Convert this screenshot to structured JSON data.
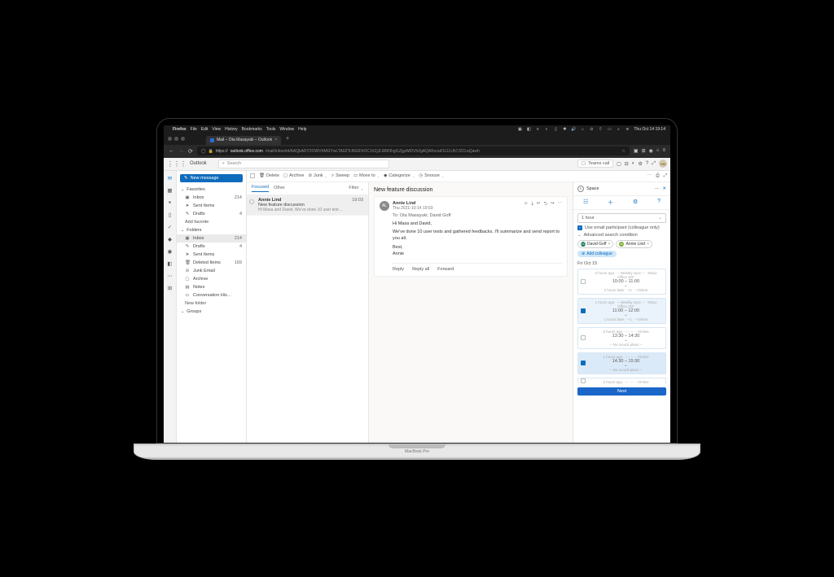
{
  "mac_menu": {
    "app": "Firefox",
    "items": [
      "File",
      "Edit",
      "View",
      "History",
      "Bookmarks",
      "Tools",
      "Window",
      "Help"
    ],
    "clock": "Thu Oct 14  19:14"
  },
  "browser": {
    "tab_title": "Mail – Ota Masayuki – Outlook",
    "url_host": "outlook.office.com",
    "url_path": "/mail/inbox/id/AAQkADY2OWVhMGYwLTA0ZTctNGFhOC1hZjJLWM3hgt1ZjgzMDVh2gAQAKuvaFG1LUh7J2CraQawh"
  },
  "outlook": {
    "title": "Outlook",
    "search_placeholder": "Search",
    "teams_call": "Teams call",
    "new_message": "New message",
    "sections": {
      "favorites": "Favorites",
      "folders": "Folders",
      "groups": "Groups",
      "add_favorite": "Add favorite",
      "new_folder": "New folder"
    },
    "folders_list": [
      {
        "icon": "inbox",
        "label": "Inbox",
        "count": "214"
      },
      {
        "icon": "send",
        "label": "Sent Items",
        "count": ""
      },
      {
        "icon": "draft",
        "label": "Drafts",
        "count": "4"
      },
      {
        "icon": "inbox",
        "label": "Inbox",
        "count": "214"
      },
      {
        "icon": "draft",
        "label": "Drafts",
        "count": "4"
      },
      {
        "icon": "send",
        "label": "Sent Items",
        "count": ""
      },
      {
        "icon": "trash",
        "label": "Deleted Items",
        "count": "169"
      },
      {
        "icon": "junk",
        "label": "Junk Email",
        "count": ""
      },
      {
        "icon": "archive",
        "label": "Archive",
        "count": ""
      },
      {
        "icon": "notes",
        "label": "Notes",
        "count": ""
      },
      {
        "icon": "conv",
        "label": "Conversation His…",
        "count": ""
      }
    ],
    "toolbar": {
      "delete": "Delete",
      "archive": "Archive",
      "junk": "Junk",
      "sweep": "Sweep",
      "move": "Move to",
      "categorize": "Categorize",
      "snooze": "Snooze"
    },
    "tabs": {
      "focused": "Focused",
      "other": "Other",
      "filter": "Filter"
    },
    "message": {
      "from": "Annie Lind",
      "time_short": "19:03",
      "subject": "New feature discussion",
      "preview": "Hi Masa and David, We've done 10 user test…",
      "initials": "AL",
      "timestamp": "Thu 2021-10-14 19:03",
      "to": "To:  Ota Masayuki; David Goff",
      "greeting": "Hi Masa and David,",
      "body": "We've done 10 user tests and gathered feedbacks. I'll summarize and send report to you all.",
      "sign1": "Best,",
      "sign2": "Annie",
      "reply": "Reply",
      "reply_all": "Reply all",
      "forward": "Forward"
    }
  },
  "space": {
    "title": "Space",
    "duration": "1 hour",
    "use_email": "Use email participant (colleague only)",
    "advanced": "Advanced search condition",
    "chips": [
      {
        "initials": "DG",
        "name": "David Goff",
        "color": "#1a7a5a"
      },
      {
        "initials": "AL",
        "name": "Annie Lind",
        "color": "#7aa82e"
      }
    ],
    "add_colleague": "Add colleague",
    "date": "Fri Oct 15",
    "slots": [
      {
        "meta1": "0 hours ago · – Weekly sync – · Tokyo Office 31F",
        "time": "10:00 – 11:00",
        "meta2": "2 hours later · +1 · –Online",
        "sel": ""
      },
      {
        "meta1": "1 hours ago · – Weekly sync – · Tokyo Office 31F",
        "time": "11:00 – 12:00",
        "meta2": "1 hours later · +1 · –Online",
        "sel": "sel1"
      },
      {
        "meta1": "3 hours ago · – · – · –Online",
        "time": "13:30 – 14:30",
        "meta2": "– No record plans –",
        "sel": ""
      },
      {
        "meta1": "1 hours ago · – · – · –Online",
        "time": "14:30 – 15:30",
        "meta2": "– No record plans –",
        "sel": "sel2"
      },
      {
        "meta1": "2 hours ago · – · – · –Online",
        "time": "",
        "meta2": "",
        "sel": ""
      }
    ],
    "next": "Next"
  },
  "laptop_label": "MacBook Pro"
}
